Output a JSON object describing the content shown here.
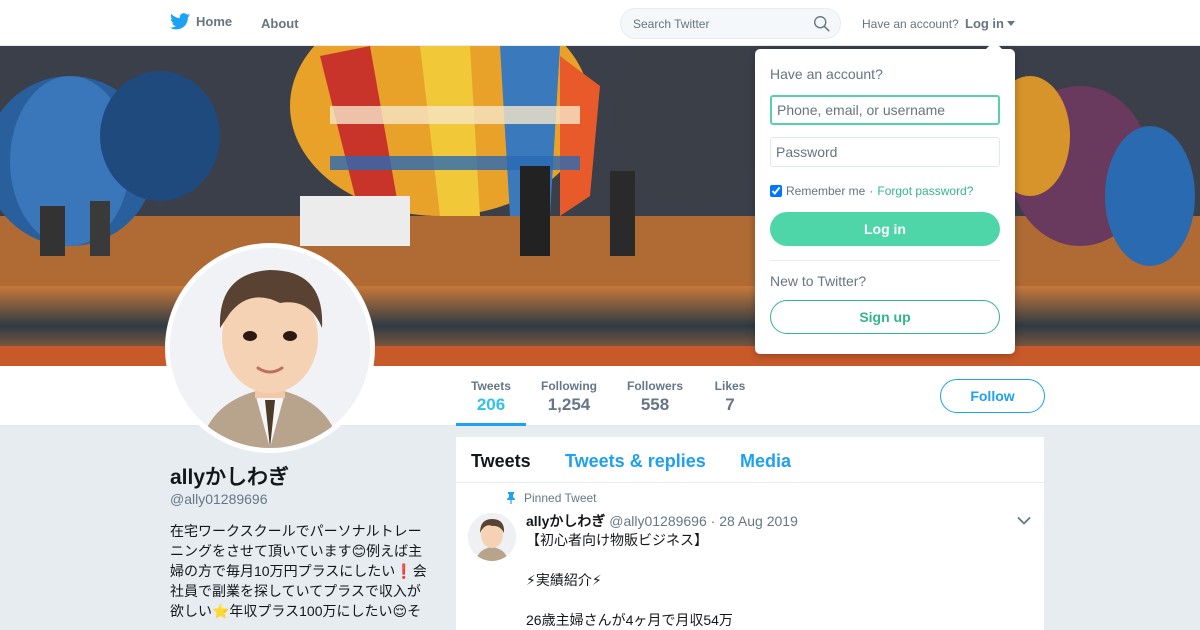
{
  "nav": {
    "home_label": "Home",
    "about_label": "About",
    "search_placeholder": "Search Twitter",
    "have_account": "Have an account?",
    "login_label": "Log in",
    "icons": {
      "logo": "twitter-bird-icon",
      "search": "search-icon",
      "caret": "caret-down-icon"
    }
  },
  "profile": {
    "name": "allyかしわぎ",
    "handle": "@ally01289696",
    "bio_lines": [
      "在宅ワークスクールでパーソナルトレー",
      "ニングをさせて頂いています😊例えば主",
      "婦の方で毎月10万円プラスにしたい❗会",
      "社員で副業を探していてプラスで収入が",
      "欲しい⭐年収プラス100万にしたい😌そ"
    ]
  },
  "stats": [
    {
      "label": "Tweets",
      "value": "206"
    },
    {
      "label": "Following",
      "value": "1,254"
    },
    {
      "label": "Followers",
      "value": "558"
    },
    {
      "label": "Likes",
      "value": "7"
    }
  ],
  "follow_label": "Follow",
  "timeline": {
    "tabs": [
      "Tweets",
      "Tweets & replies",
      "Media"
    ],
    "pinned_label": "Pinned Tweet",
    "tweet": {
      "name": "allyかしわぎ",
      "handle": "@ally01289696",
      "separator": "·",
      "date": "28 Aug 2019",
      "lines": [
        "【初心者向け物販ビジネス】",
        "",
        "⚡実績紹介⚡",
        "",
        "26歳主婦さんが4ヶ月で月収54万"
      ]
    }
  },
  "login_dropdown": {
    "title": "Have an account?",
    "username_placeholder": "Phone, email, or username",
    "password_placeholder": "Password",
    "remember_label": "Remember me",
    "separator": "·",
    "forgot_label": "Forgot password?",
    "login_button": "Log in",
    "new_label": "New to Twitter?",
    "signup_button": "Sign up"
  },
  "colors": {
    "twitter_blue": "#1da1f2",
    "login_green": "#4fd6a8",
    "text_gray": "#657786",
    "page_bg": "#e6ecf0"
  }
}
